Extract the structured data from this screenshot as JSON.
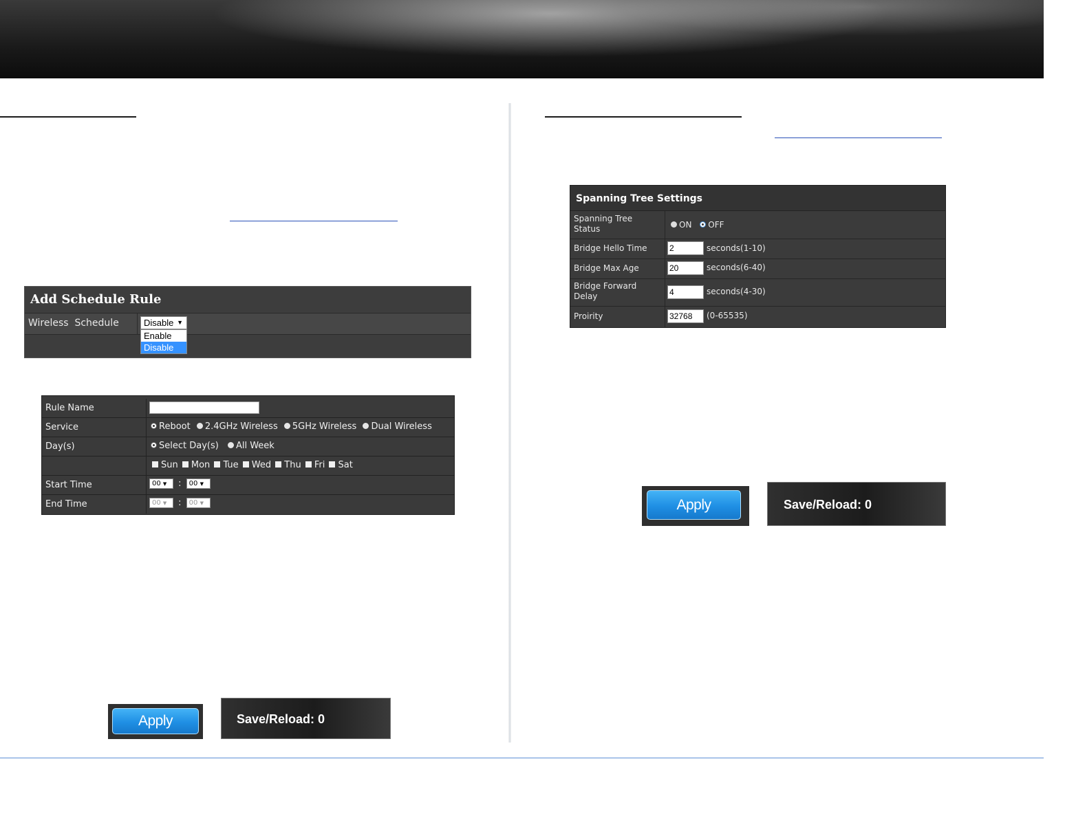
{
  "schedule": {
    "panel_title": "Add Schedule Rule",
    "wireless_schedule_label": "Wireless  Schedule",
    "selected_value": "Disable",
    "options": [
      "Enable",
      "Disable"
    ],
    "highlighted_option": "Disable"
  },
  "rule_table": {
    "rule_name_label": "Rule Name",
    "rule_name_value": "",
    "service_label": "Service",
    "services": [
      "Reboot",
      "2.4GHz Wireless",
      "5GHz Wireless",
      "Dual Wireless"
    ],
    "selected_service": "Reboot",
    "days_label": "Day(s)",
    "day_modes": [
      "Select Day(s)",
      "All Week"
    ],
    "selected_day_mode": "Select Day(s)",
    "days": [
      "Sun",
      "Mon",
      "Tue",
      "Wed",
      "Thu",
      "Fri",
      "Sat"
    ],
    "start_time_label": "Start Time",
    "start_hour": "00",
    "start_minute": "00",
    "end_time_label": "End Time",
    "end_hour": "00",
    "end_minute": "00",
    "time_sep": ":"
  },
  "left_buttons": {
    "apply_label": "Apply",
    "save_reload_label": "Save/Reload: 0"
  },
  "spanning_tree": {
    "panel_title": "Spanning Tree Settings",
    "status_label": "Spanning Tree Status",
    "status_on_label": "ON",
    "status_off_label": "OFF",
    "status_value": "OFF",
    "hello_time_label": "Bridge Hello Time",
    "hello_time_value": "2",
    "hello_time_hint": "seconds(1-10)",
    "max_age_label": "Bridge Max Age",
    "max_age_value": "20",
    "max_age_hint": "seconds(6-40)",
    "forward_delay_label": "Bridge Forward Delay",
    "forward_delay_value": "4",
    "forward_delay_hint": "seconds(4-30)",
    "priority_label": "Proirity",
    "priority_value": "32768",
    "priority_hint": "(0-65535)"
  },
  "right_buttons": {
    "apply_label": "Apply",
    "save_reload_label": "Save/Reload: 0"
  }
}
